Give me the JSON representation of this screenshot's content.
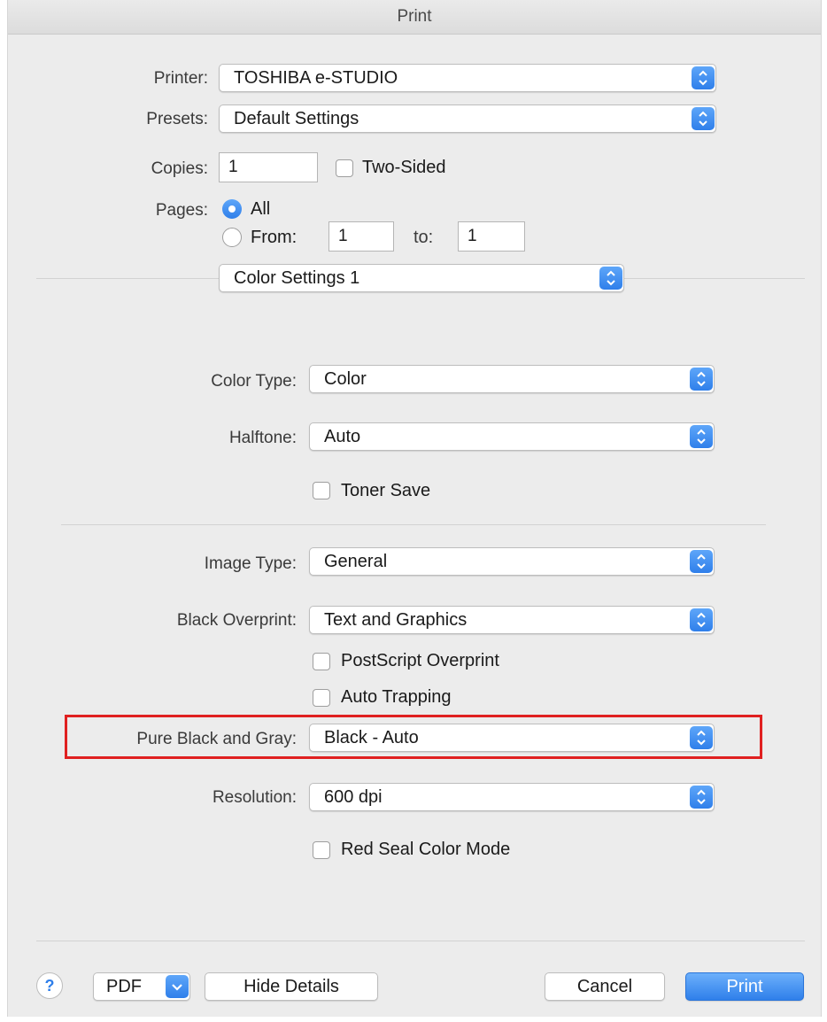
{
  "window": {
    "title": "Print"
  },
  "top_form": {
    "printer_label": "Printer:",
    "printer_value": "TOSHIBA e-STUDIO",
    "presets_label": "Presets:",
    "presets_value": "Default Settings",
    "copies_label": "Copies:",
    "copies_value": "1",
    "two_sided_label": "Two-Sided",
    "pages_label": "Pages:",
    "pages_all_label": "All",
    "pages_from_label": "From:",
    "pages_from_value": "1",
    "pages_to_label": "to:",
    "pages_to_value": "1",
    "panel_selector_value": "Color Settings 1"
  },
  "color_settings": {
    "color_type_label": "Color Type:",
    "color_type_value": "Color",
    "halftone_label": "Halftone:",
    "halftone_value": "Auto",
    "toner_save_label": "Toner Save",
    "image_type_label": "Image Type:",
    "image_type_value": "General",
    "black_overprint_label": "Black Overprint:",
    "black_overprint_value": "Text and Graphics",
    "postscript_overprint_label": "PostScript Overprint",
    "auto_trapping_label": "Auto Trapping",
    "pure_black_gray_label": "Pure Black and Gray:",
    "pure_black_gray_value": "Black - Auto",
    "resolution_label": "Resolution:",
    "resolution_value": "600 dpi",
    "red_seal_label": "Red Seal Color Mode"
  },
  "footer": {
    "help_label": "?",
    "pdf_label": "PDF",
    "hide_details_label": "Hide Details",
    "cancel_label": "Cancel",
    "print_label": "Print"
  },
  "colors": {
    "accent": "#2f7fea",
    "highlight_box": "#e02020",
    "window_bg": "#ececec"
  },
  "icons": {
    "popup_stepper": "up-down-chevron-icon",
    "pdf_menu": "chevron-down-icon",
    "help": "question-mark-icon"
  }
}
